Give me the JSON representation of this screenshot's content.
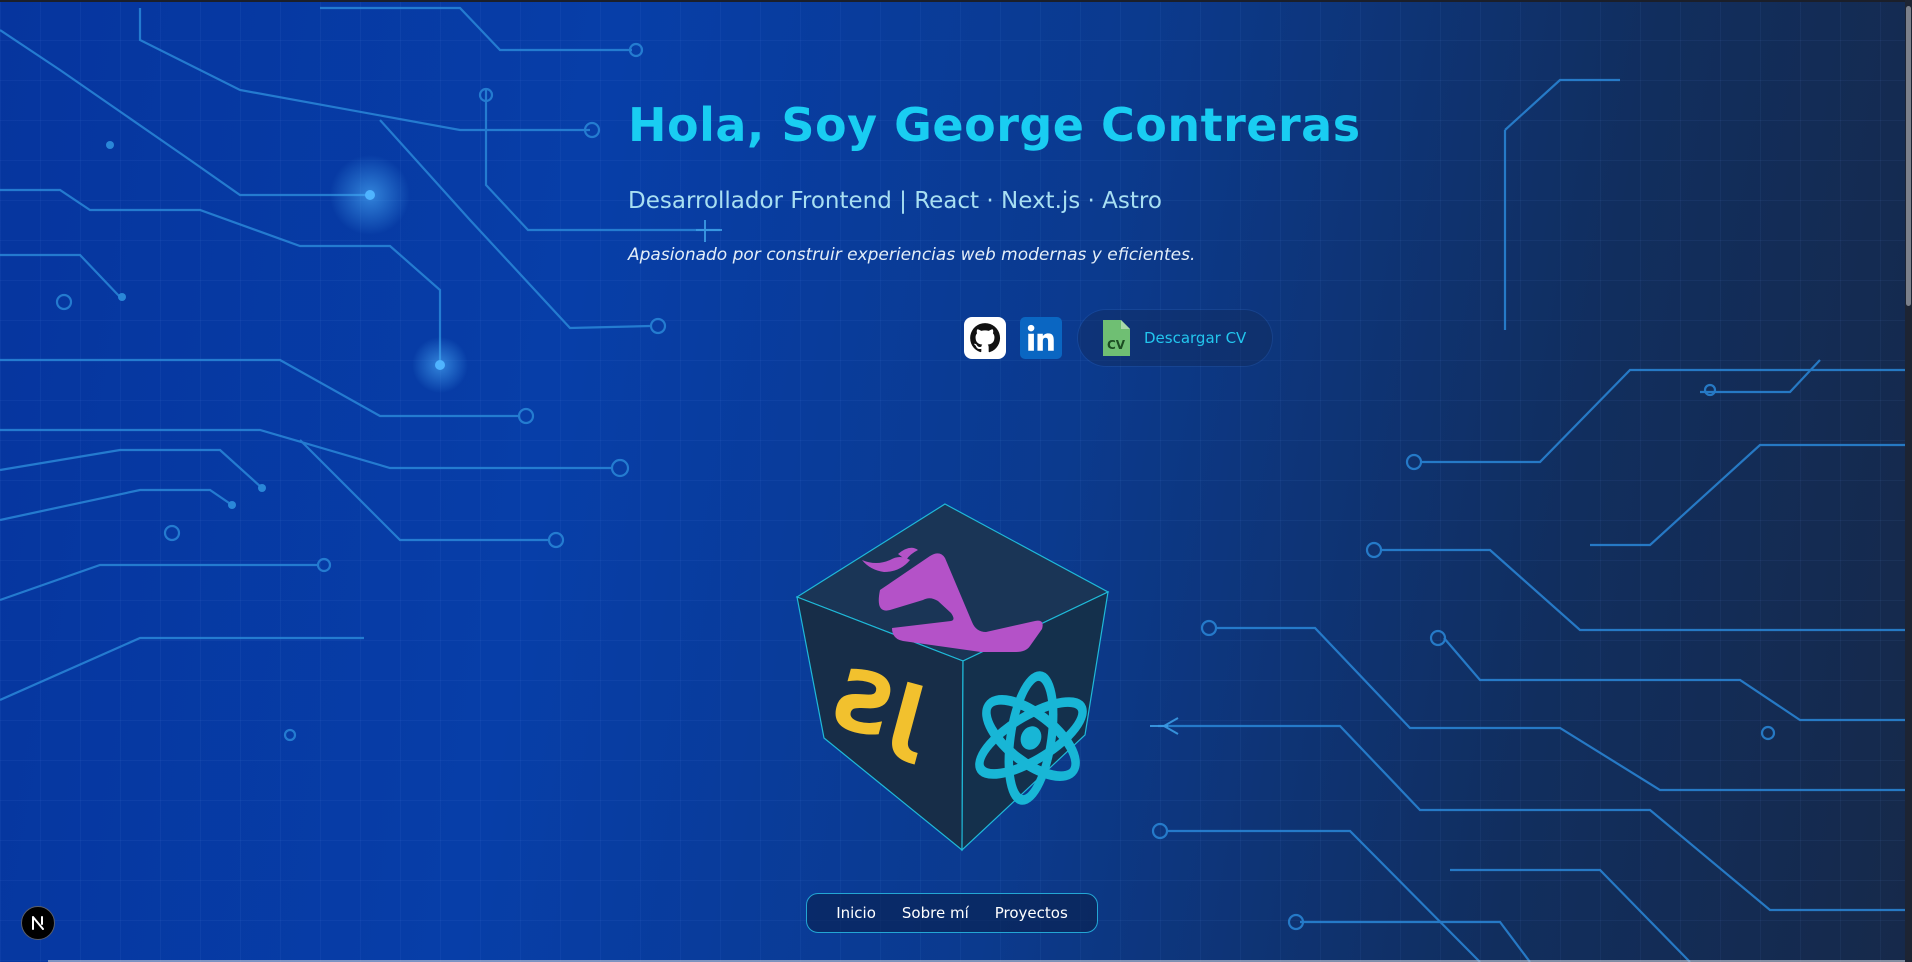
{
  "hero": {
    "title": "Hola, Soy George Contreras",
    "subtitle": "Desarrollador Frontend | React · Next.js · Astro",
    "tagline": "Apasionado por construir experiencias web modernas y eficientes."
  },
  "social": {
    "github_icon": "github-icon",
    "linkedin_icon": "linkedin-icon",
    "cv_icon": "cv-file-icon",
    "cv_label": "Descargar CV"
  },
  "cube": {
    "faces": [
      "vite-icon",
      "javascript-icon",
      "react-icon"
    ],
    "colors": {
      "vite": "#b452c8",
      "js": "#f2c12e",
      "react": "#18b6d6",
      "face": "#15304f"
    }
  },
  "nav": {
    "items": [
      "Inicio",
      "Sobre mí",
      "Proyectos"
    ]
  },
  "badge": {
    "label": "N"
  },
  "theme": {
    "accent": "#19cdf2",
    "subtitle": "#a8dff2"
  }
}
